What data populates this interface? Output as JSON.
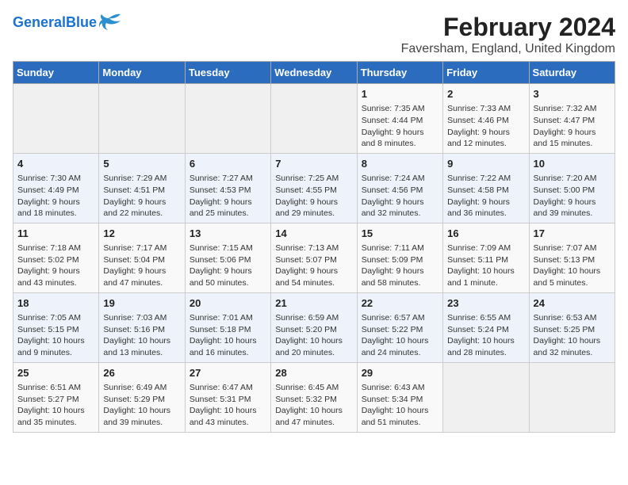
{
  "header": {
    "logo_general": "General",
    "logo_blue": "Blue",
    "month_title": "February 2024",
    "location": "Faversham, England, United Kingdom"
  },
  "weekdays": [
    "Sunday",
    "Monday",
    "Tuesday",
    "Wednesday",
    "Thursday",
    "Friday",
    "Saturday"
  ],
  "weeks": [
    [
      null,
      null,
      null,
      null,
      {
        "day": "1",
        "sunrise": "7:35 AM",
        "sunset": "4:44 PM",
        "daylight": "9 hours and 8 minutes."
      },
      {
        "day": "2",
        "sunrise": "7:33 AM",
        "sunset": "4:46 PM",
        "daylight": "9 hours and 12 minutes."
      },
      {
        "day": "3",
        "sunrise": "7:32 AM",
        "sunset": "4:47 PM",
        "daylight": "9 hours and 15 minutes."
      }
    ],
    [
      {
        "day": "4",
        "sunrise": "7:30 AM",
        "sunset": "4:49 PM",
        "daylight": "9 hours and 18 minutes."
      },
      {
        "day": "5",
        "sunrise": "7:29 AM",
        "sunset": "4:51 PM",
        "daylight": "9 hours and 22 minutes."
      },
      {
        "day": "6",
        "sunrise": "7:27 AM",
        "sunset": "4:53 PM",
        "daylight": "9 hours and 25 minutes."
      },
      {
        "day": "7",
        "sunrise": "7:25 AM",
        "sunset": "4:55 PM",
        "daylight": "9 hours and 29 minutes."
      },
      {
        "day": "8",
        "sunrise": "7:24 AM",
        "sunset": "4:56 PM",
        "daylight": "9 hours and 32 minutes."
      },
      {
        "day": "9",
        "sunrise": "7:22 AM",
        "sunset": "4:58 PM",
        "daylight": "9 hours and 36 minutes."
      },
      {
        "day": "10",
        "sunrise": "7:20 AM",
        "sunset": "5:00 PM",
        "daylight": "9 hours and 39 minutes."
      }
    ],
    [
      {
        "day": "11",
        "sunrise": "7:18 AM",
        "sunset": "5:02 PM",
        "daylight": "9 hours and 43 minutes."
      },
      {
        "day": "12",
        "sunrise": "7:17 AM",
        "sunset": "5:04 PM",
        "daylight": "9 hours and 47 minutes."
      },
      {
        "day": "13",
        "sunrise": "7:15 AM",
        "sunset": "5:06 PM",
        "daylight": "9 hours and 50 minutes."
      },
      {
        "day": "14",
        "sunrise": "7:13 AM",
        "sunset": "5:07 PM",
        "daylight": "9 hours and 54 minutes."
      },
      {
        "day": "15",
        "sunrise": "7:11 AM",
        "sunset": "5:09 PM",
        "daylight": "9 hours and 58 minutes."
      },
      {
        "day": "16",
        "sunrise": "7:09 AM",
        "sunset": "5:11 PM",
        "daylight": "10 hours and 1 minute."
      },
      {
        "day": "17",
        "sunrise": "7:07 AM",
        "sunset": "5:13 PM",
        "daylight": "10 hours and 5 minutes."
      }
    ],
    [
      {
        "day": "18",
        "sunrise": "7:05 AM",
        "sunset": "5:15 PM",
        "daylight": "10 hours and 9 minutes."
      },
      {
        "day": "19",
        "sunrise": "7:03 AM",
        "sunset": "5:16 PM",
        "daylight": "10 hours and 13 minutes."
      },
      {
        "day": "20",
        "sunrise": "7:01 AM",
        "sunset": "5:18 PM",
        "daylight": "10 hours and 16 minutes."
      },
      {
        "day": "21",
        "sunrise": "6:59 AM",
        "sunset": "5:20 PM",
        "daylight": "10 hours and 20 minutes."
      },
      {
        "day": "22",
        "sunrise": "6:57 AM",
        "sunset": "5:22 PM",
        "daylight": "10 hours and 24 minutes."
      },
      {
        "day": "23",
        "sunrise": "6:55 AM",
        "sunset": "5:24 PM",
        "daylight": "10 hours and 28 minutes."
      },
      {
        "day": "24",
        "sunrise": "6:53 AM",
        "sunset": "5:25 PM",
        "daylight": "10 hours and 32 minutes."
      }
    ],
    [
      {
        "day": "25",
        "sunrise": "6:51 AM",
        "sunset": "5:27 PM",
        "daylight": "10 hours and 35 minutes."
      },
      {
        "day": "26",
        "sunrise": "6:49 AM",
        "sunset": "5:29 PM",
        "daylight": "10 hours and 39 minutes."
      },
      {
        "day": "27",
        "sunrise": "6:47 AM",
        "sunset": "5:31 PM",
        "daylight": "10 hours and 43 minutes."
      },
      {
        "day": "28",
        "sunrise": "6:45 AM",
        "sunset": "5:32 PM",
        "daylight": "10 hours and 47 minutes."
      },
      {
        "day": "29",
        "sunrise": "6:43 AM",
        "sunset": "5:34 PM",
        "daylight": "10 hours and 51 minutes."
      },
      null,
      null
    ]
  ]
}
